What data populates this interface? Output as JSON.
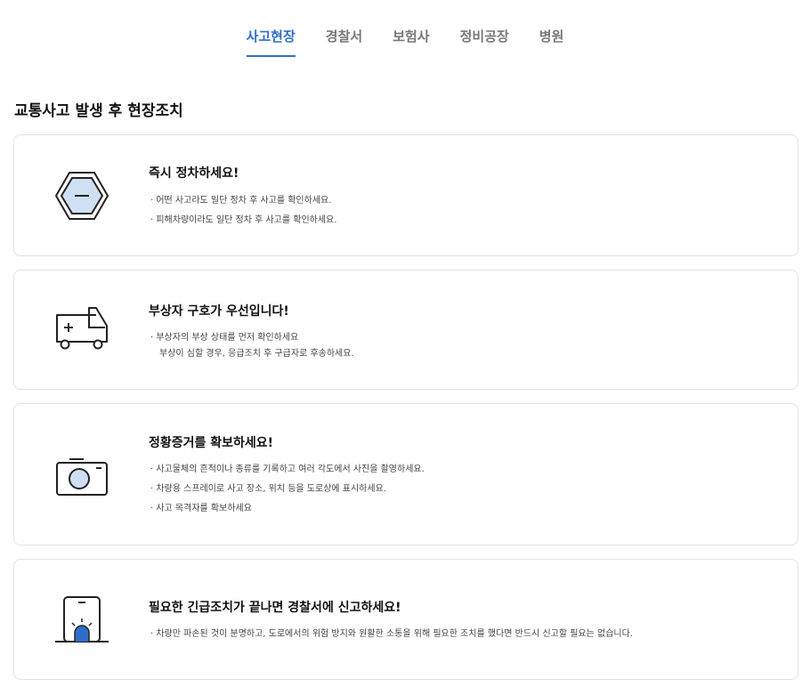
{
  "tabs": [
    {
      "label": "사고현장",
      "active": true
    },
    {
      "label": "경찰서",
      "active": false
    },
    {
      "label": "보험사",
      "active": false
    },
    {
      "label": "정비공장",
      "active": false
    },
    {
      "label": "병원",
      "active": false
    }
  ],
  "section_title": "교통사고 발생 후 현장조치",
  "cards": [
    {
      "icon": "hexagon-stop-icon",
      "title": "즉시 정차하세요!",
      "items": [
        "· 어떤 사고라도 일단 정차 후 사고를 확인하세요.",
        "· 피해차량이라도 일단 정차 후 사고를 확인하세요."
      ]
    },
    {
      "icon": "ambulance-icon",
      "title": "부상자 구호가 우선입니다!",
      "items": [
        "· 부상자의 부상 상태를 먼저 확인하세요",
        "부상이 심할 경우, 응급조치 후 구급자로 후송하세요."
      ]
    },
    {
      "icon": "camera-icon",
      "title": "정황증거를 확보하세요!",
      "items": [
        "· 사고물체의 흔적이나 종류를 기록하고 여러 각도에서 사진을 촬영하세요.",
        "· 차량용 스프레이로 사고 장소, 위치 등을 도로상에 표시하세요.",
        "· 사고 목격자를 확보하세요"
      ]
    },
    {
      "icon": "phone-siren-icon",
      "title": "필요한 긴급조치가 끝나면 경찰서에 신고하세요!",
      "items": [
        "· 차량만 파손된 것이 분명하고, 도로에서의 위험 방지와 원활한 소통을 위해 필요한 조치를 했다면 반드시 신고할 필요는 없습니다."
      ]
    }
  ],
  "colors": {
    "accent": "#2f6ec8",
    "icon_fill": "#cfe0f5",
    "border": "#e3e3e3"
  }
}
